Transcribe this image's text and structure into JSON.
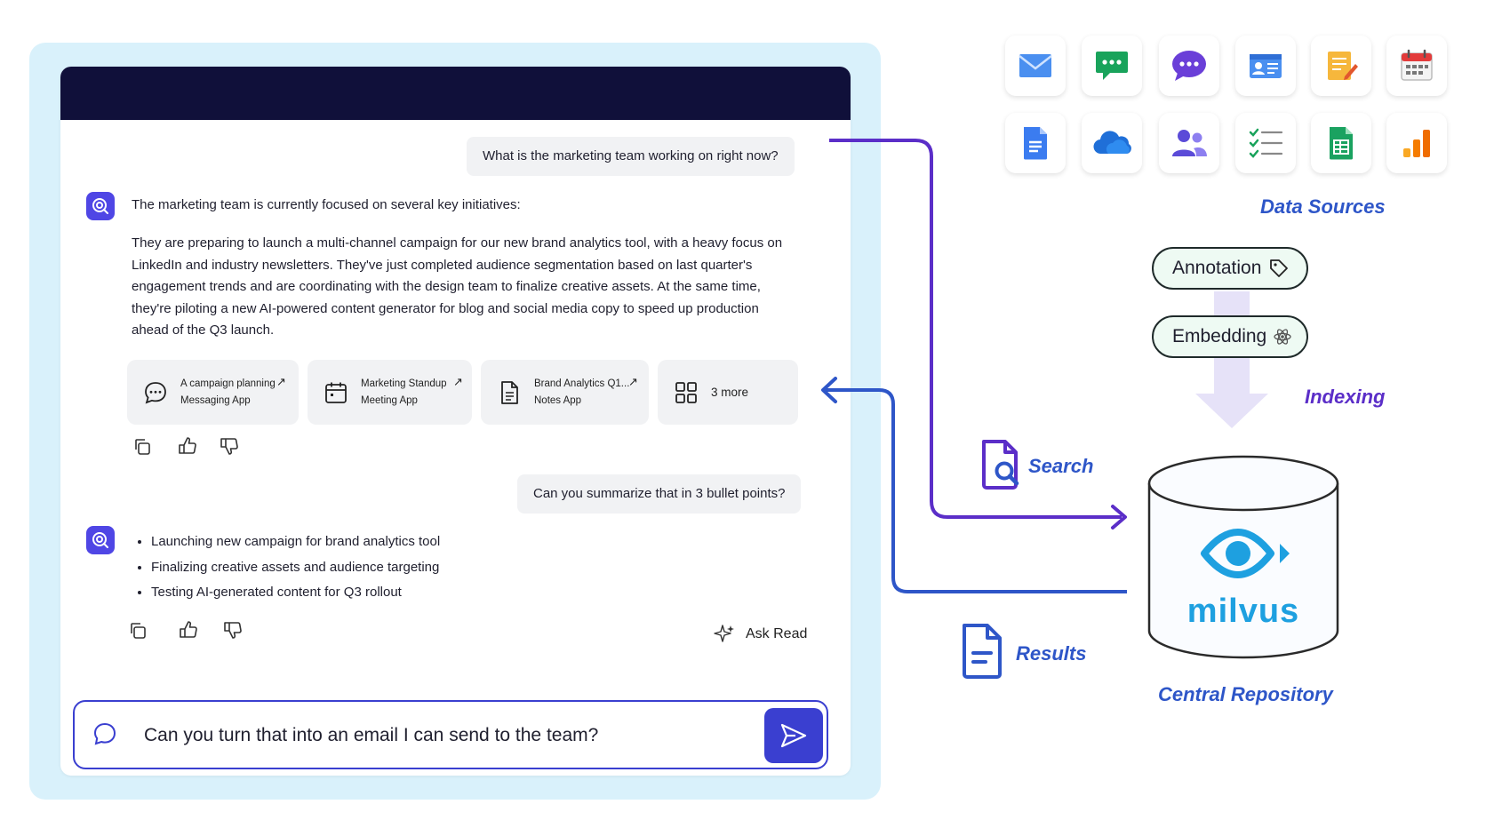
{
  "chat": {
    "question_1": "What is the marketing team working on right now?",
    "answer_intro": "The marketing team is currently focused on several key initiatives:",
    "answer_lines": [
      "They are preparing to launch a multi-channel campaign for our new brand analytics tool, with a heavy focus on",
      "LinkedIn and industry newsletters. They've just completed audience segmentation based on last quarter's",
      "engagement trends and are coordinating with the design team to finalize creative assets. At the same time,",
      "they're piloting a new AI-powered content generator for blog and social media copy to speed up production",
      "ahead of the Q3 launch."
    ],
    "sources": [
      {
        "title": "A campaign planning",
        "app": "Messaging App",
        "icon": "chat-bubble-icon"
      },
      {
        "title": "Marketing Standup",
        "app": "Meeting App",
        "icon": "calendar-icon"
      },
      {
        "title": "Brand Analytics Q1...",
        "app": "Notes App",
        "icon": "document-icon"
      }
    ],
    "more_sources": "3 more",
    "question_2": "Can you summarize that in 3 bullet points?",
    "bullets": [
      "Launching new campaign for brand analytics tool",
      "Finalizing creative assets and audience targeting",
      "Testing AI-generated content for Q3 rollout"
    ],
    "ask_read": "Ask Read",
    "composer_value": "Can you turn that into an email I can send to the team?"
  },
  "diagram": {
    "data_sources_label": "Data Sources",
    "apps": [
      "mail-icon",
      "message-icon",
      "chat-icon",
      "contact-card-icon",
      "notes-icon",
      "calendar-icon",
      "docs-icon",
      "cloud-icon",
      "people-icon",
      "checklist-icon",
      "sheets-icon",
      "analytics-icon"
    ],
    "annotation_label": "Annotation",
    "embedding_label": "Embedding",
    "indexing_label": "Indexing",
    "search_label": "Search",
    "results_label": "Results",
    "repository_brand": "milvus",
    "repository_label": "Central Repository",
    "colors": {
      "accent": "#3a3fd0",
      "flow_search": "#5b2ec8",
      "flow_results": "#2e56c8",
      "milvus": "#1ea0e0"
    }
  }
}
